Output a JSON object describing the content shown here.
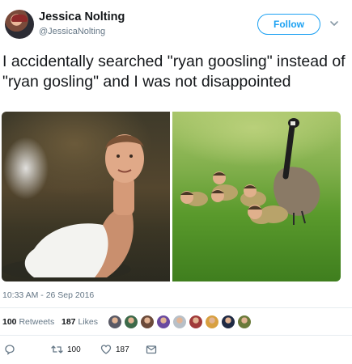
{
  "author": {
    "display_name": "Jessica Nolting",
    "handle": "@JessicaNolting"
  },
  "follow_label": "Follow",
  "tweet_text": "I accidentally searched \"ryan goosling\" instead of \"ryan gosling\" and I was not disappointed",
  "timestamp": "10:33 AM - 26 Sep 2016",
  "stats": {
    "retweets_count": "100",
    "retweets_label": "Retweets",
    "likes_count": "187",
    "likes_label": "Likes"
  },
  "liker_avatar_colors": [
    "#5a5a66",
    "#3d6a4a",
    "#6b4a3a",
    "#6a4aa0",
    "#b8c0c8",
    "#a03a3a",
    "#d8a040",
    "#1f2a44",
    "#6a7a3a"
  ],
  "actions": {
    "reply_icon": "reply-icon",
    "retweet_count": "100",
    "like_count": "187",
    "message_icon": "envelope-icon"
  },
  "colors": {
    "accent": "#1da1f2",
    "secondary_text": "#657786"
  }
}
